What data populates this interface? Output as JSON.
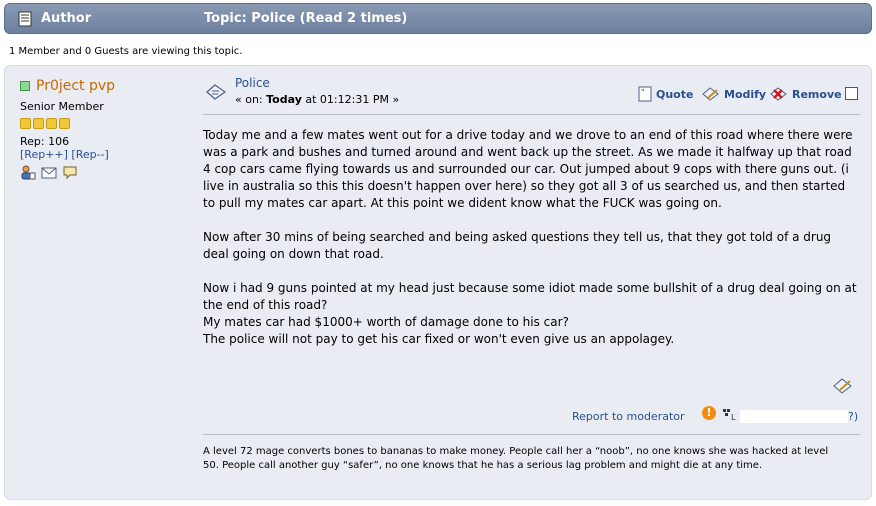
{
  "header": {
    "author_label": "Author",
    "topic_label": "Topic: Police  (Read 2 times)"
  },
  "viewing": "1 Member and 0 Guests are viewing this topic.",
  "poster": {
    "name": "Pr0ject pvp",
    "title": "Senior Member",
    "stars": 4,
    "rep": "Rep: 106",
    "rep_plus": "[Rep++]",
    "rep_minus": "[Rep--]"
  },
  "message": {
    "subject": "Police",
    "posted_prefix": "« on: ",
    "posted_day": "Today",
    "posted_time": " at 01:12:31 PM »",
    "paragraphs": [
      "Today me and a few mates went out for a drive today and we drove to an end of this road where there were was a park and bushes and turned around and went back up the street. As we made it halfway up that road 4 cop cars came flying towards us and surrounded our car. Out jumped about 9 cops with there guns out. (i live in australia so this this doesn't happen over here) so they got all 3 of us searched us, and then started to pull my mates car apart. At this point we dident know what the FUCK was going on.",
      "Now after 30 mins of being searched and being asked questions they tell us, that they got told of a drug deal going on down that road.",
      "Now i had 9 guns pointed at my head just because some idiot made some bullshit of a drug deal going on at the end of this road?\nMy mates car had $1000+ worth of damage done to his car?\nThe police will not pay to get his car fixed or won't even give us an appolagey."
    ]
  },
  "actions": {
    "quote": "Quote",
    "modify": "Modify",
    "remove": "Remove"
  },
  "report": {
    "label": "Report to moderator",
    "ip_suffix": "?)"
  },
  "signature": "A level 72 mage converts bones to bananas to make money. People call her a “noob”, no one knows she was hacked at level 50. People call another guy “safer”, no one knows that he has a serious lag problem and might die at any time.",
  "colors": {
    "header_bg": "#7587a7",
    "post_bg": "#e9edf3",
    "link": "#2a4f8d",
    "poster_name": "#cc6600"
  }
}
